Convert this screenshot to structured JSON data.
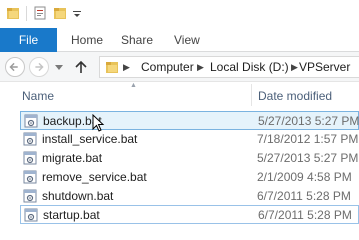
{
  "ribbon": {
    "tabs": [
      {
        "label": "File",
        "active": true
      },
      {
        "label": "Home"
      },
      {
        "label": "Share"
      },
      {
        "label": "View"
      }
    ]
  },
  "address_bar": {
    "breadcrumbs": [
      "Computer",
      "Local Disk (D:)",
      "VPServer"
    ]
  },
  "columns": {
    "name": "Name",
    "date_modified": "Date modified"
  },
  "files": [
    {
      "name": "backup.bat",
      "date": "5/27/2013 5:27 PM",
      "state": "hover"
    },
    {
      "name": "install_service.bat",
      "date": "7/18/2012 1:57 PM"
    },
    {
      "name": "migrate.bat",
      "date": "5/27/2013 5:27 PM"
    },
    {
      "name": "remove_service.bat",
      "date": "2/1/2009 4:58 PM"
    },
    {
      "name": "shutdown.bat",
      "date": "6/7/2011 5:28 PM"
    },
    {
      "name": "startup.bat",
      "date": "6/7/2011 5:28 PM",
      "state": "selected"
    }
  ],
  "colors": {
    "file_tab": "#1979ca",
    "hover_fill": "#e5f3fb",
    "hover_border": "#7ab3e0",
    "header_text": "#4c607a"
  },
  "icons": {
    "quick_access": [
      "folder-icon",
      "properties-icon",
      "new-folder-icon",
      "customize-dropdown-icon"
    ],
    "file": "batch-file-icon"
  }
}
